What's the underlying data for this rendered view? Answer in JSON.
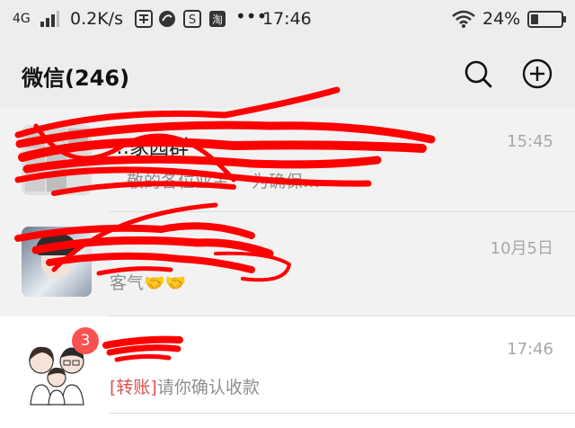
{
  "status_bar": {
    "network": "4G",
    "speed": "0.2K/s",
    "dots": "•••",
    "time": "17:46",
    "battery": "24%"
  },
  "header": {
    "title": "微信(246)",
    "search_icon": "search-icon",
    "add_icon": "plus-circle-icon"
  },
  "chats": [
    {
      "name": "…家园群",
      "time": "15:45",
      "preview": "…敬的各位业主：   为确保…"
    },
    {
      "name": "",
      "time": "10月5日",
      "preview": "客气🤝🤝"
    },
    {
      "name": "",
      "time": "17:46",
      "preview_tag": "[转账]",
      "preview": "请你确认收款",
      "badge": "3"
    }
  ],
  "colors": {
    "header_bg": "#ededed",
    "badge": "#fa5151",
    "scribble": "#ff0000"
  }
}
